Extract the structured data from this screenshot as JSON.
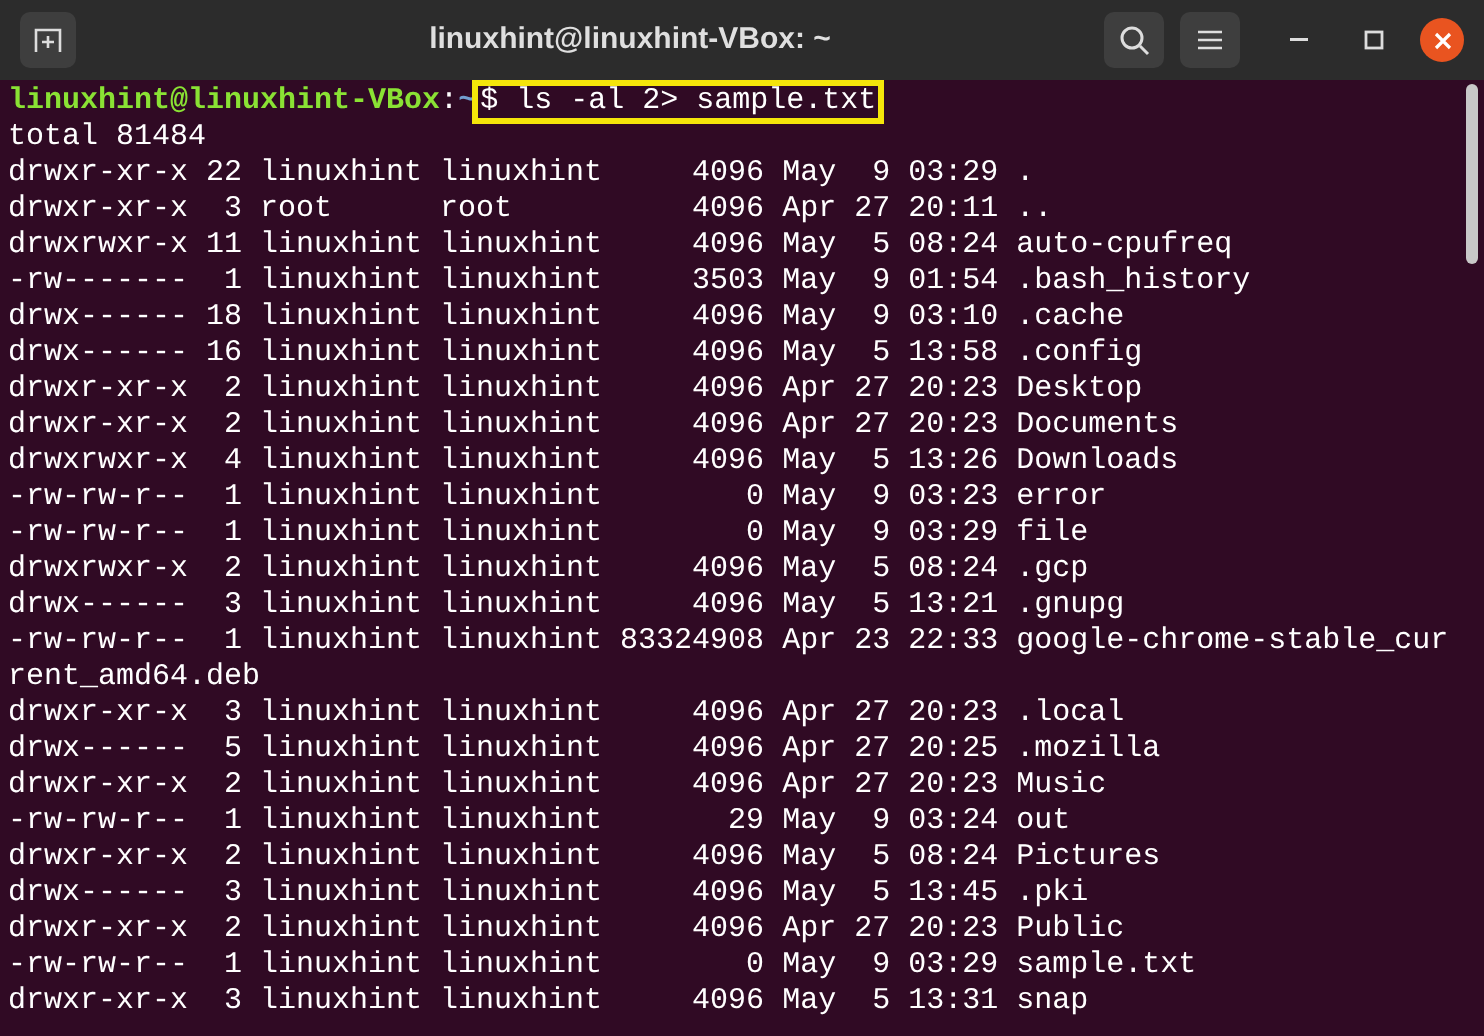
{
  "window": {
    "title": "linuxhint@linuxhint-VBox: ~"
  },
  "prompt": {
    "user_host": "linuxhint@linuxhint-VBox",
    "separator": ":",
    "path": "~",
    "command": "$ ls -al 2> sample.txt",
    "highlighted": true
  },
  "output": [
    "total 81484",
    "drwxr-xr-x 22 linuxhint linuxhint     4096 May  9 03:29 .",
    "drwxr-xr-x  3 root      root          4096 Apr 27 20:11 ..",
    "drwxrwxr-x 11 linuxhint linuxhint     4096 May  5 08:24 auto-cpufreq",
    "-rw-------  1 linuxhint linuxhint     3503 May  9 01:54 .bash_history",
    "drwx------ 18 linuxhint linuxhint     4096 May  9 03:10 .cache",
    "drwx------ 16 linuxhint linuxhint     4096 May  5 13:58 .config",
    "drwxr-xr-x  2 linuxhint linuxhint     4096 Apr 27 20:23 Desktop",
    "drwxr-xr-x  2 linuxhint linuxhint     4096 Apr 27 20:23 Documents",
    "drwxrwxr-x  4 linuxhint linuxhint     4096 May  5 13:26 Downloads",
    "-rw-rw-r--  1 linuxhint linuxhint        0 May  9 03:23 error",
    "-rw-rw-r--  1 linuxhint linuxhint        0 May  9 03:29 file",
    "drwxrwxr-x  2 linuxhint linuxhint     4096 May  5 08:24 .gcp",
    "drwx------  3 linuxhint linuxhint     4096 May  5 13:21 .gnupg",
    "-rw-rw-r--  1 linuxhint linuxhint 83324908 Apr 23 22:33 google-chrome-stable_cur",
    "rent_amd64.deb",
    "drwxr-xr-x  3 linuxhint linuxhint     4096 Apr 27 20:23 .local",
    "drwx------  5 linuxhint linuxhint     4096 Apr 27 20:25 .mozilla",
    "drwxr-xr-x  2 linuxhint linuxhint     4096 Apr 27 20:23 Music",
    "-rw-rw-r--  1 linuxhint linuxhint       29 May  9 03:24 out",
    "drwxr-xr-x  2 linuxhint linuxhint     4096 May  5 08:24 Pictures",
    "drwx------  3 linuxhint linuxhint     4096 May  5 13:45 .pki",
    "drwxr-xr-x  2 linuxhint linuxhint     4096 Apr 27 20:23 Public",
    "-rw-rw-r--  1 linuxhint linuxhint        0 May  9 03:29 sample.txt",
    "drwxr-xr-x  3 linuxhint linuxhint     4096 May  5 13:31 snap"
  ]
}
